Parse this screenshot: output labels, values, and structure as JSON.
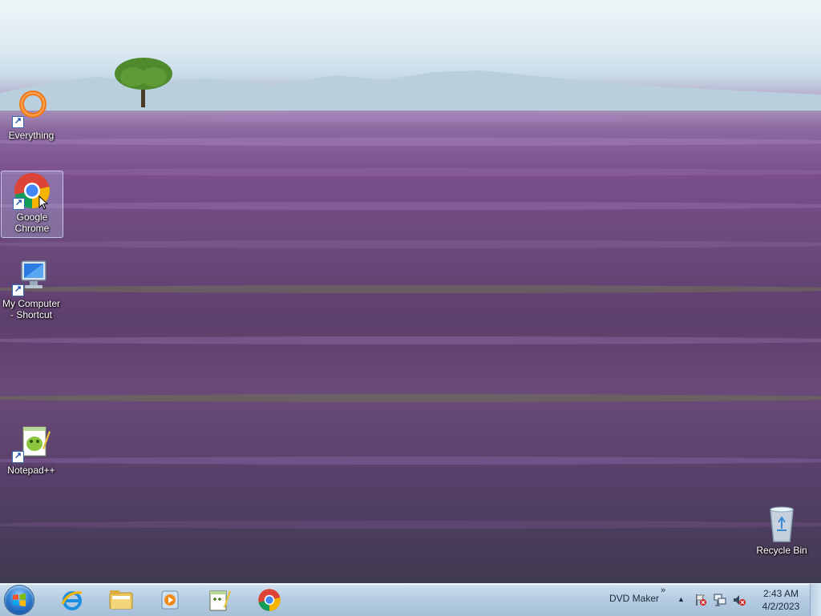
{
  "desktop": {
    "icons": [
      {
        "label": "Everything",
        "icon": "everything-icon"
      },
      {
        "label": "Google\nChrome",
        "icon": "chrome-icon"
      },
      {
        "label": "My Computer\n- Shortcut",
        "icon": "computer-icon"
      },
      {
        "label": "Notepad++",
        "icon": "notepad-plus-plus-icon"
      },
      {
        "label": "Recycle Bin",
        "icon": "recycle-bin-icon"
      }
    ],
    "shortcut_arrow": "↗"
  },
  "taskbar": {
    "pinned": [
      {
        "name": "internet-explorer",
        "icon": "internet-explorer-icon"
      },
      {
        "name": "windows-explorer",
        "icon": "folder-icon"
      },
      {
        "name": "media-player",
        "icon": "media-player-icon"
      },
      {
        "name": "notepad-plus-plus",
        "icon": "notepad-plus-plus-icon"
      },
      {
        "name": "google-chrome",
        "icon": "chrome-icon"
      }
    ],
    "toolbar_label": "DVD Maker",
    "toolbar_chevron": "»",
    "tray_arrow": "▲",
    "clock": {
      "time": "2:43 AM",
      "date": "4/2/2023"
    }
  },
  "colors": {
    "taskbar": "#b6cde2",
    "lavender": "#7a4f8c",
    "sky": "#dbe9f1"
  }
}
